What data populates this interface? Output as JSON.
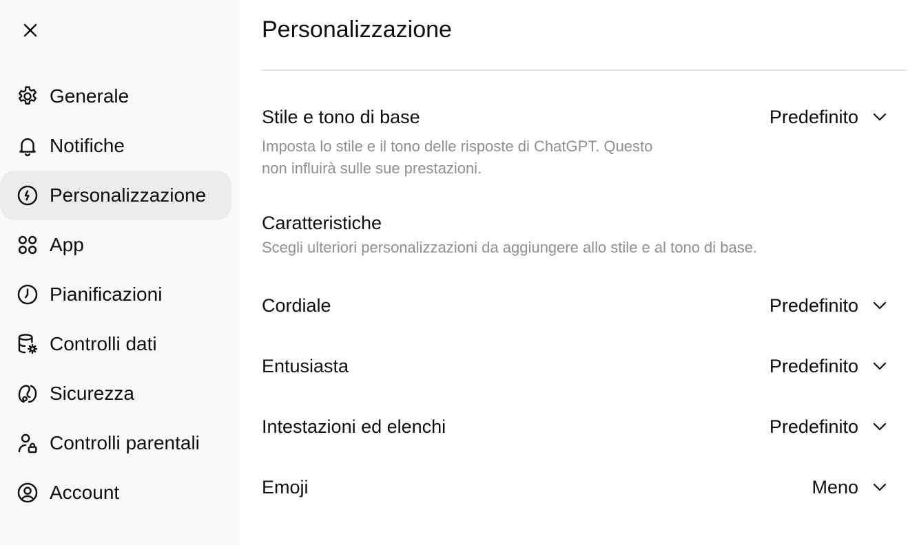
{
  "header": {
    "close_icon": "close-icon",
    "title": "Personalizzazione"
  },
  "sidebar": {
    "items": [
      {
        "label": "Generale",
        "icon": "gear-icon",
        "active": false
      },
      {
        "label": "Notifiche",
        "icon": "bell-icon",
        "active": false
      },
      {
        "label": "Personalizzazione",
        "icon": "personalization-icon",
        "active": true
      },
      {
        "label": "App",
        "icon": "apps-grid-icon",
        "active": false
      },
      {
        "label": "Pianificazioni",
        "icon": "clock-icon",
        "active": false
      },
      {
        "label": "Controlli dati",
        "icon": "database-gear-icon",
        "active": false
      },
      {
        "label": "Sicurezza",
        "icon": "security-icon",
        "active": false
      },
      {
        "label": "Controlli parentali",
        "icon": "parental-lock-icon",
        "active": false
      },
      {
        "label": "Account",
        "icon": "account-icon",
        "active": false
      }
    ]
  },
  "settings": {
    "base_style": {
      "label": "Stile e tono di base",
      "value": "Predefinito",
      "description_line1": "Imposta lo stile e il tono delle risposte di ChatGPT. Questo",
      "description_line2": "non influirà sulle sue prestazioni."
    },
    "traits": {
      "label": "Caratteristiche",
      "description": "Scegli ulteriori personalizzazioni da aggiungere allo stile e al tono di base."
    },
    "warm": {
      "label": "Cordiale",
      "value": "Predefinito"
    },
    "enthusiastic": {
      "label": "Entusiasta",
      "value": "Predefinito"
    },
    "headers_lists": {
      "label": "Intestazioni ed elenchi",
      "value": "Predefinito"
    },
    "emoji": {
      "label": "Emoji",
      "value": "Meno"
    }
  },
  "colors": {
    "sidebar_bg": "#f9f9f9",
    "active_item_bg": "#ececec",
    "text": "#0d0d0d",
    "muted_text": "#8f8f8f",
    "divider": "#e3e3e3"
  }
}
